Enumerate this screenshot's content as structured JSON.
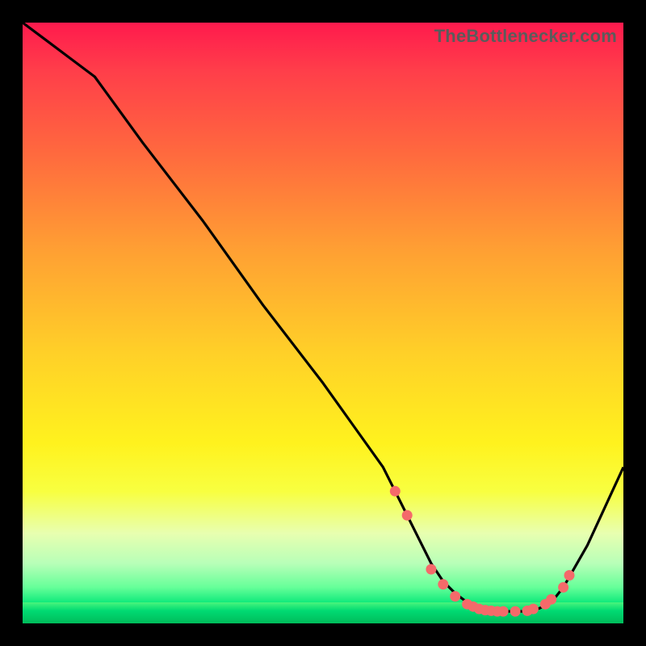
{
  "watermark": "TheBottlenecker.com",
  "gradient_colors": {
    "top": "#ff1a4d",
    "mid": "#fff21e",
    "bottom": "#00c853"
  },
  "chart_data": {
    "type": "line",
    "title": "",
    "xlabel": "",
    "ylabel": "",
    "xlim": [
      0,
      100
    ],
    "ylim": [
      0,
      100
    ],
    "x": [
      0,
      4,
      8,
      12,
      20,
      30,
      40,
      50,
      55,
      60,
      62,
      64,
      66,
      68,
      70,
      72,
      74,
      76,
      78,
      80,
      82,
      84,
      86,
      88,
      90,
      94,
      100
    ],
    "values": [
      100,
      97,
      94,
      91,
      80,
      67,
      53,
      40,
      33,
      26,
      22,
      18,
      14,
      10,
      7,
      5,
      3.5,
      2.5,
      2,
      2,
      2,
      2,
      2.5,
      3.5,
      6,
      13,
      26
    ],
    "markers": {
      "x": [
        62,
        64,
        68,
        70,
        72,
        74,
        75,
        76,
        77,
        78,
        79,
        80,
        82,
        84,
        85,
        87,
        88,
        90,
        91
      ],
      "y": [
        22,
        18,
        9,
        6.5,
        4.5,
        3.2,
        2.8,
        2.4,
        2.2,
        2.1,
        2,
        2,
        2,
        2.1,
        2.4,
        3.2,
        4,
        6,
        8
      ]
    }
  }
}
